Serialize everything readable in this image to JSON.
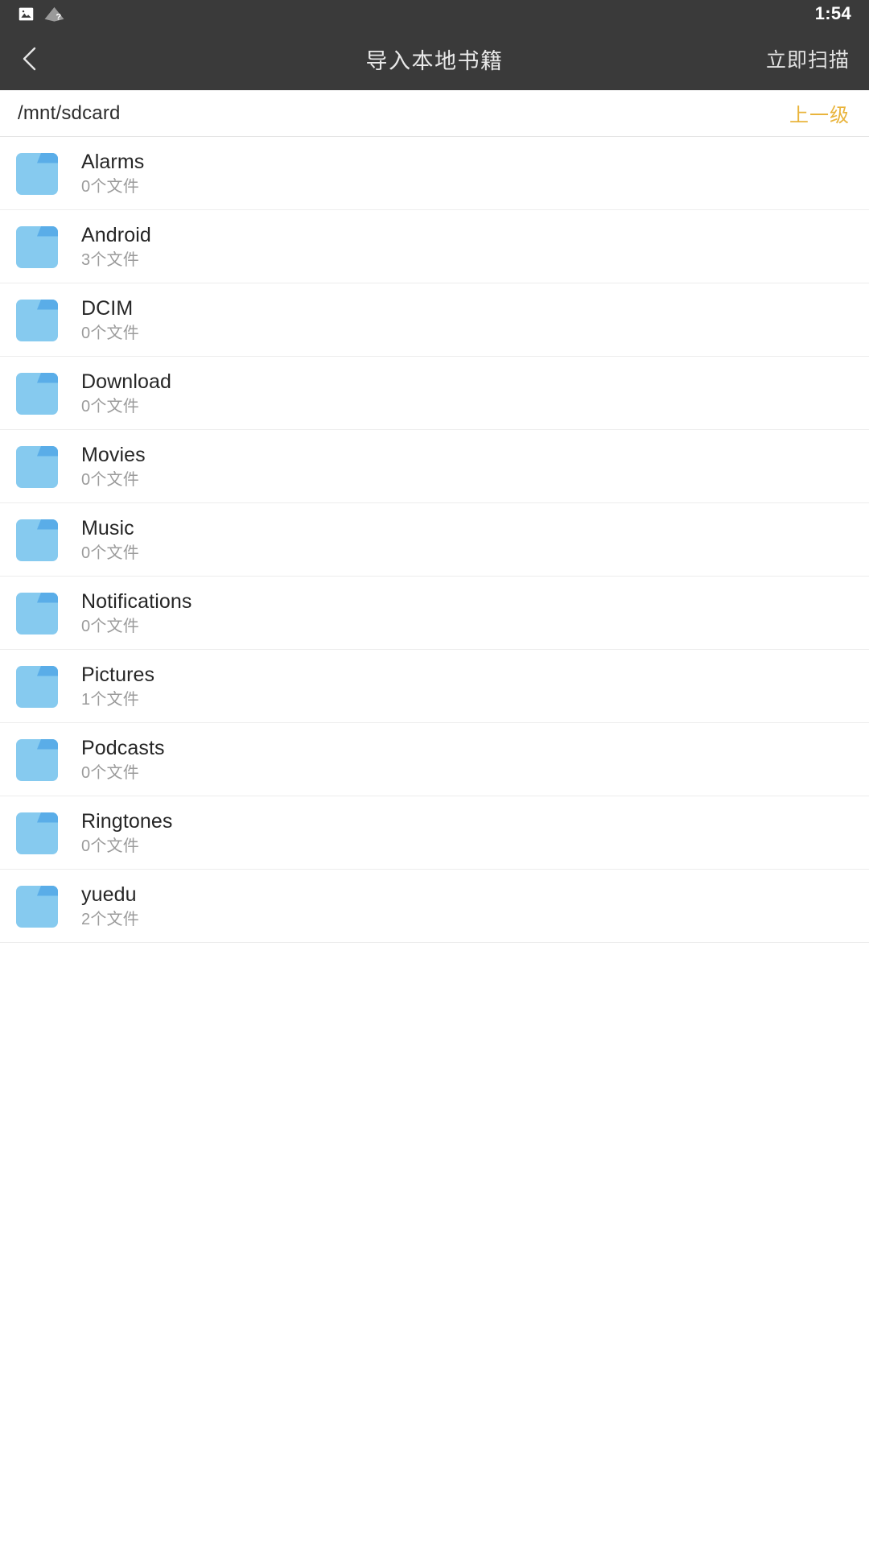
{
  "status_bar": {
    "time": "1:54",
    "icons": [
      {
        "name": "photo-icon",
        "glyph": "photo"
      },
      {
        "name": "wifi-question-icon",
        "glyph": "wifi-unknown"
      }
    ],
    "background_color": "#3a3a3a",
    "text_color": "#ffffff"
  },
  "app_bar": {
    "back_icon": "chevron-left-icon",
    "title": "导入本地书籍",
    "action_label": "立即扫描",
    "background_color": "#3a3a3a",
    "title_color": "#e9e9e9"
  },
  "path_bar": {
    "current_path": "/mnt/sdcard",
    "up_label": "上一级",
    "up_color": "#e9b43c"
  },
  "file_list": {
    "folder_icon_color": "#86caef",
    "folder_tab_color": "#5aade8",
    "items": [
      {
        "name": "Alarms",
        "count": "0个文件",
        "icon": "folder-icon"
      },
      {
        "name": "Android",
        "count": "3个文件",
        "icon": "folder-icon"
      },
      {
        "name": "DCIM",
        "count": "0个文件",
        "icon": "folder-icon"
      },
      {
        "name": "Download",
        "count": "0个文件",
        "icon": "folder-icon"
      },
      {
        "name": "Movies",
        "count": "0个文件",
        "icon": "folder-icon"
      },
      {
        "name": "Music",
        "count": "0个文件",
        "icon": "folder-icon"
      },
      {
        "name": "Notifications",
        "count": "0个文件",
        "icon": "folder-icon"
      },
      {
        "name": "Pictures",
        "count": "1个文件",
        "icon": "folder-icon"
      },
      {
        "name": "Podcasts",
        "count": "0个文件",
        "icon": "folder-icon"
      },
      {
        "name": "Ringtones",
        "count": "0个文件",
        "icon": "folder-icon"
      },
      {
        "name": "yuedu",
        "count": "2个文件",
        "icon": "folder-icon"
      }
    ]
  }
}
